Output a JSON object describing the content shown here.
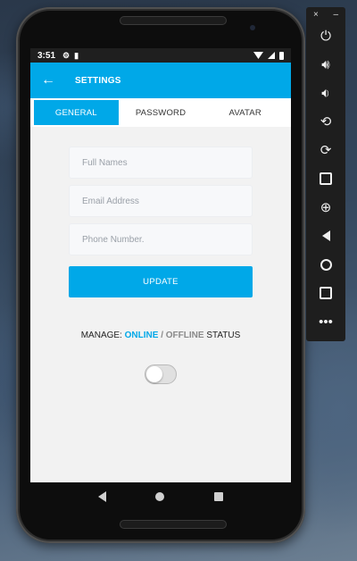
{
  "status_bar": {
    "time": "3:51"
  },
  "app_bar": {
    "back_icon": "arrow-left-icon",
    "title": "SETTINGS"
  },
  "tabs": [
    {
      "label": "GENERAL",
      "active": true
    },
    {
      "label": "PASSWORD",
      "active": false
    },
    {
      "label": "AVATAR",
      "active": false
    }
  ],
  "form": {
    "full_names_placeholder": "Full Names",
    "email_placeholder": "Email Address",
    "phone_placeholder": "Phone Number.",
    "update_label": "UPDATE"
  },
  "status": {
    "prefix": "MANAGE:",
    "online": "ONLINE",
    "separator": "/",
    "offline": "OFFLINE",
    "suffix": "STATUS",
    "toggle_on": false
  },
  "colors": {
    "accent": "#00a8e8",
    "offline": "#8a8a8a"
  },
  "emulator_toolbar": {
    "close_glyph": "×",
    "minimize_glyph": "–",
    "buttons": [
      "power-icon",
      "volume-up-icon",
      "volume-down-icon",
      "rotate-left-icon",
      "rotate-right-icon",
      "camera-icon",
      "zoom-icon",
      "back-icon",
      "home-icon",
      "overview-icon",
      "more-icon"
    ]
  }
}
